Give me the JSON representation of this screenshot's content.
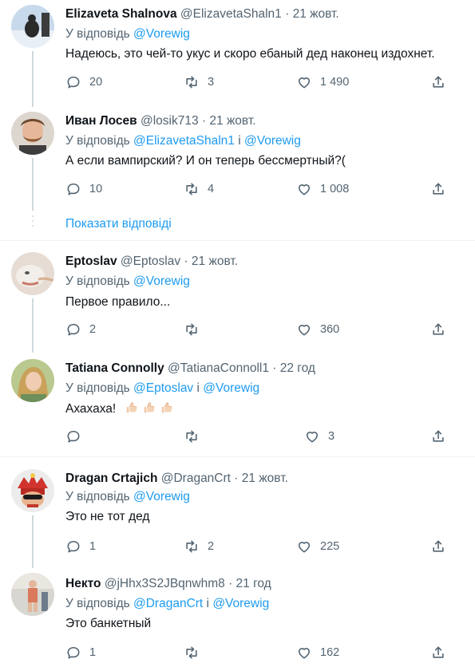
{
  "tweets": [
    {
      "name": "Elizaveta Shalnova",
      "handle": "@ElizavetaShaln1",
      "dot": "·",
      "time": "21 жовт.",
      "reply_prefix": "У відповідь",
      "reply_mentions": "@Vorewig",
      "reply_join": "",
      "reply_mentions2": "",
      "text": "Надеюсь, это чей-то укус и скоро ебаный дед наконец издохнет.",
      "replies": "20",
      "retweets": "3",
      "likes": "1 490"
    },
    {
      "name": "Иван Лосев",
      "handle": "@losik713",
      "dot": "·",
      "time": "21 жовт.",
      "reply_prefix": "У відповідь",
      "reply_mentions": "@ElizavetaShaln1",
      "reply_join": "і",
      "reply_mentions2": "@Vorewig",
      "text": "А если вампирский? И он теперь бессмертный?(",
      "replies": "10",
      "retweets": "4",
      "likes": "1 008"
    },
    {
      "name": "Eptoslav",
      "handle": "@Eptoslav",
      "dot": "·",
      "time": "21 жовт.",
      "reply_prefix": "У відповідь",
      "reply_mentions": "@Vorewig",
      "reply_join": "",
      "reply_mentions2": "",
      "text": "Первое правило...",
      "replies": "2",
      "retweets": "",
      "likes": "360"
    },
    {
      "name": "Tatiana Connolly",
      "handle": "@TatianaConnoll1",
      "dot": "·",
      "time": "22 год",
      "reply_prefix": "У відповідь",
      "reply_mentions": "@Eptoslav",
      "reply_join": "і",
      "reply_mentions2": "@Vorewig",
      "text": "Ахахаха!",
      "replies": "",
      "retweets": "",
      "likes": "3"
    },
    {
      "name": "Dragan Crtajich",
      "handle": "@DraganCrt",
      "dot": "·",
      "time": "21 жовт.",
      "reply_prefix": "У відповідь",
      "reply_mentions": "@Vorewig",
      "reply_join": "",
      "reply_mentions2": "",
      "text": "Это не тот дед",
      "replies": "1",
      "retweets": "2",
      "likes": "225"
    },
    {
      "name": "Некто",
      "handle": "@jHhx3S2JBqnwhm8",
      "dot": "·",
      "time": "21 год",
      "reply_prefix": "У відповідь",
      "reply_mentions": "@DraganCrt",
      "reply_join": "і",
      "reply_mentions2": "@Vorewig",
      "text": "Это банкетный",
      "replies": "1",
      "retweets": "",
      "likes": "162"
    }
  ],
  "show_replies": "Показати відповіді",
  "colors": {
    "accent": "#1d9bf0",
    "muted": "#536471",
    "text": "#0f1419",
    "divider": "#eff3f4",
    "thread_line": "#cfd9de"
  },
  "icons": [
    "reply-icon",
    "retweet-icon",
    "like-icon",
    "share-icon",
    "thumbs-up-emoji"
  ]
}
